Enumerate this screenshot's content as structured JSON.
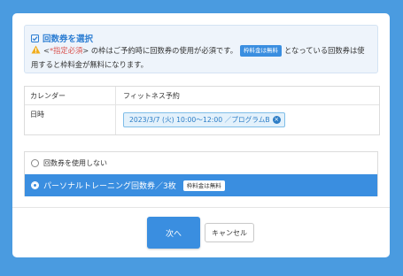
{
  "info": {
    "title": "回数券を選択",
    "warning_prefix": "<",
    "required_label": "*指定必須",
    "warning_mid": "> の枠はご予約時に回数券の使用が必須です。",
    "free_badge": "枠料金は無料",
    "warning_suffix": "となっている回数券は使",
    "line2": "用すると枠料金が無料になります。"
  },
  "details": {
    "calendar_label": "カレンダー",
    "calendar_value": "フィットネス予約",
    "date_label": "日時",
    "date_value": "2023/3/7 (火) 10:00〜12:00 ／プログラムB"
  },
  "options": {
    "none_label": "回数券を使用しない",
    "selected_label": "パーソナルトレーニング回数券／3枚",
    "selected_badge": "枠料金は無料"
  },
  "buttons": {
    "next": "次へ",
    "cancel": "キャンセル"
  },
  "colors": {
    "background": "#4a9be0",
    "accent": "#3a8ee0",
    "required": "#d9534f",
    "warning": "#f0ad1e"
  },
  "icons": {
    "title_icon": "checkbox-icon",
    "warning_icon": "warning-icon",
    "remove_icon": "close-circle-icon"
  }
}
